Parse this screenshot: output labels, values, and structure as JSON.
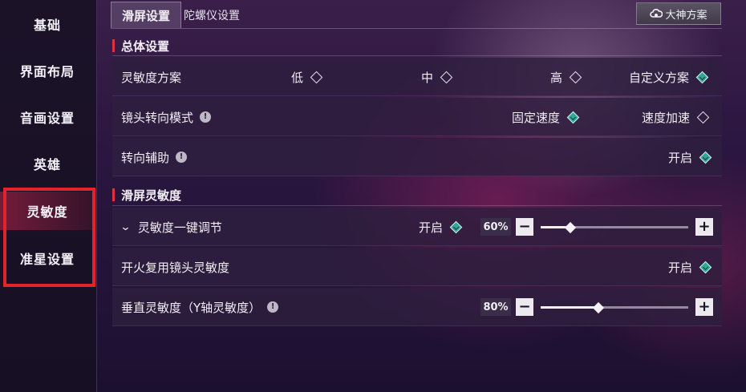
{
  "sidebar": {
    "items": [
      {
        "label": "基础"
      },
      {
        "label": "界面布局"
      },
      {
        "label": "音画设置"
      },
      {
        "label": "英雄"
      },
      {
        "label": "灵敏度"
      },
      {
        "label": "准星设置"
      }
    ],
    "active_index": 4
  },
  "tabs": {
    "active": "滑屏设置",
    "inactive": "陀螺仪设置"
  },
  "expert_button": {
    "label": "大神方案",
    "icon": "cloud-icon"
  },
  "section_general": {
    "title": "总体设置"
  },
  "sensitivity_scheme": {
    "label": "灵敏度方案",
    "options": [
      "低",
      "中",
      "高",
      "自定义方案"
    ],
    "selected": "自定义方案"
  },
  "camera_turn_mode": {
    "label": "镜头转向模式",
    "options": [
      "固定速度",
      "速度加速"
    ],
    "selected": "固定速度"
  },
  "turn_assist": {
    "label": "转向辅助",
    "option": "开启",
    "on": true
  },
  "section_swipe": {
    "title": "滑屏灵敏度"
  },
  "one_key_adjust": {
    "label": "灵敏度一键调节",
    "option": "开启",
    "on": true,
    "value": 0.6,
    "value_text": "60%"
  },
  "fire_reuse": {
    "label": "开火复用镜头灵敏度",
    "option": "开启",
    "on": true
  },
  "vertical_sens": {
    "label": "垂直灵敏度（Y轴灵敏度）",
    "value": 0.8,
    "value_text": "80%"
  },
  "colors": {
    "accent_teal": "#2fa89a",
    "highlight_red": "#e3232b",
    "section_bar_red": "#e0323c"
  }
}
